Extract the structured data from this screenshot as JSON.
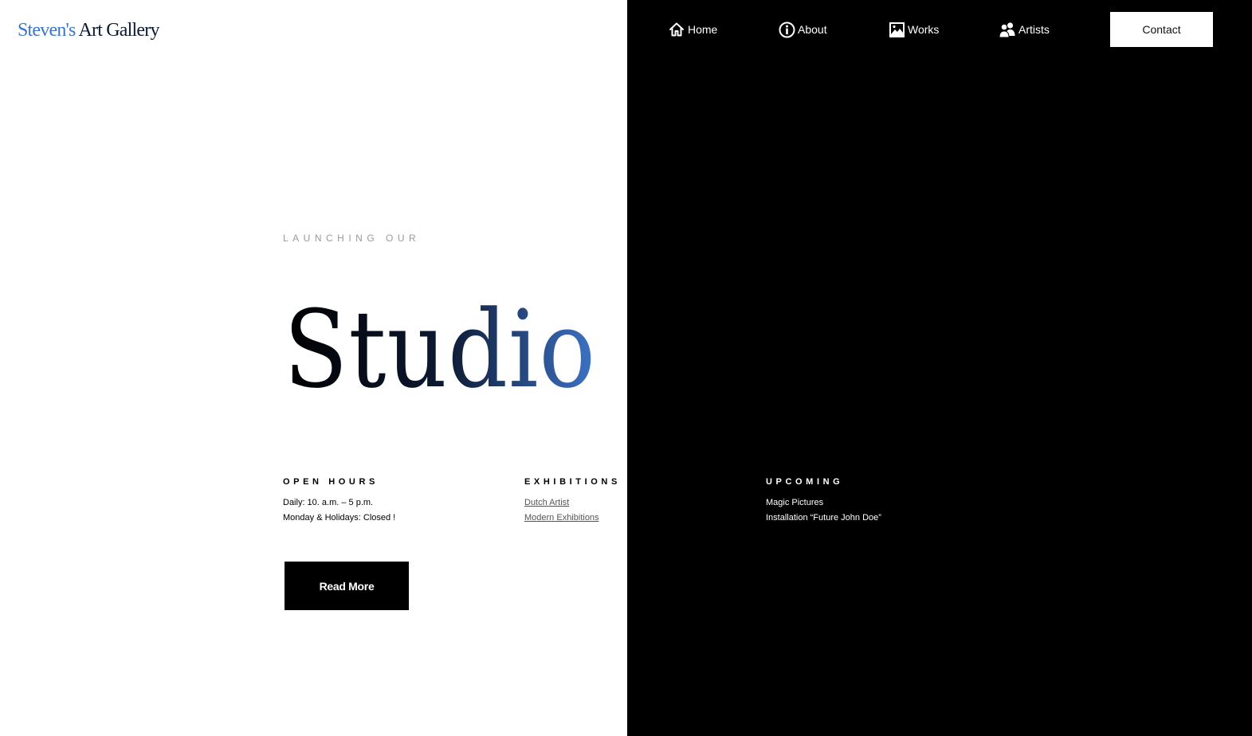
{
  "brand": {
    "logo_part1": "Steven's",
    "logo_part2": "Art Gallery",
    "accent_color": "#3d74c7",
    "dark_color": "#0d1a33"
  },
  "nav": {
    "items": [
      {
        "label": "Home",
        "icon": "home-icon"
      },
      {
        "label": "About",
        "icon": "info-icon"
      },
      {
        "label": "Works",
        "icon": "image-icon"
      },
      {
        "label": "Artists",
        "icon": "users-icon"
      }
    ],
    "contact_label": "Contact"
  },
  "hero": {
    "eyebrow": "LAUNCHING OUR",
    "title": "Studio",
    "title_gradient": [
      "#000000",
      "#0d1a33",
      "#3d74c7"
    ]
  },
  "info": {
    "open_hours": {
      "heading": "OPEN HOURS",
      "lines": [
        "Daily: 10. a.m. – 5 p.m.",
        "Monday & Holidays: Closed !"
      ]
    },
    "exhibitions": {
      "heading": "EXHIBITIONS",
      "links": [
        "Dutch Artist",
        "Modern Exhibitions"
      ]
    },
    "upcoming": {
      "heading": "UPCOMING",
      "lines": [
        "Magic Pictures",
        "Installation “Future John Doe”"
      ]
    }
  },
  "cta": {
    "read_more_label": "Read More"
  }
}
